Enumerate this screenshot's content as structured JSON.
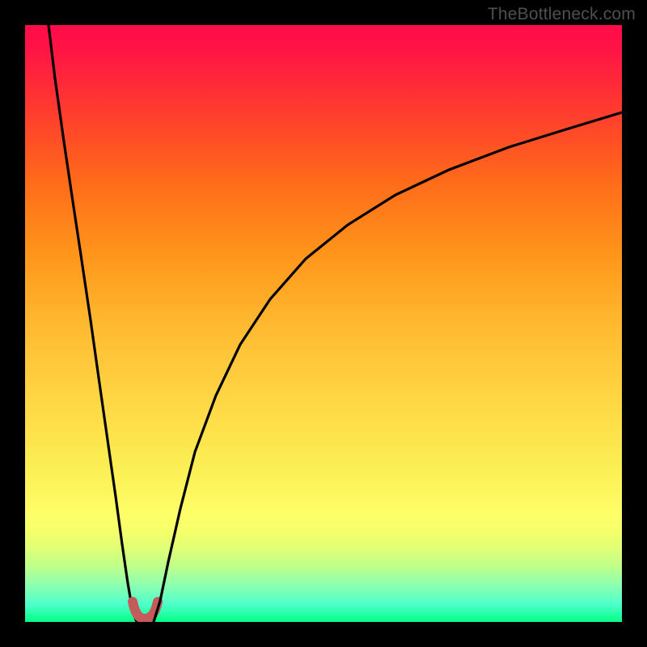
{
  "attribution": "TheBottleneck.com",
  "chart_data": {
    "type": "line",
    "title": "",
    "xlabel": "",
    "ylabel": "",
    "xlim": [
      0,
      100
    ],
    "ylim": [
      0,
      100
    ],
    "background_gradient": {
      "top": "#ff0b49",
      "bottom": "#03ff84",
      "meaning": "vertical gradient from red (high/bad) at top to green (low/good) at bottom"
    },
    "series": [
      {
        "name": "left-branch",
        "stroke": "#000000",
        "x": [
          3.9,
          5.0,
          6.5,
          8.0,
          9.5,
          11.0,
          12.5,
          14.0,
          15.2,
          16.3,
          17.2,
          18.0,
          18.7
        ],
        "y": [
          100.0,
          91.0,
          80.5,
          70.5,
          60.5,
          50.5,
          40.0,
          29.5,
          21.0,
          13.0,
          6.5,
          1.8,
          0.0
        ]
      },
      {
        "name": "dip-marker",
        "stroke": "#c45a5a",
        "x": [
          18.0,
          18.7,
          19.4,
          20.1,
          20.9,
          21.6,
          22.3
        ],
        "y": [
          3.4,
          1.5,
          0.6,
          0.4,
          0.6,
          1.5,
          3.4
        ]
      },
      {
        "name": "right-branch",
        "stroke": "#000000",
        "x": [
          21.6,
          22.6,
          24.0,
          26.0,
          28.5,
          32.0,
          36.0,
          41.0,
          47.0,
          54.0,
          62.0,
          71.0,
          81.0,
          91.0,
          100.0
        ],
        "y": [
          0.0,
          3.5,
          10.0,
          19.0,
          28.5,
          38.0,
          46.5,
          54.0,
          60.8,
          66.5,
          71.5,
          75.7,
          79.5,
          82.7,
          85.3
        ]
      }
    ]
  }
}
